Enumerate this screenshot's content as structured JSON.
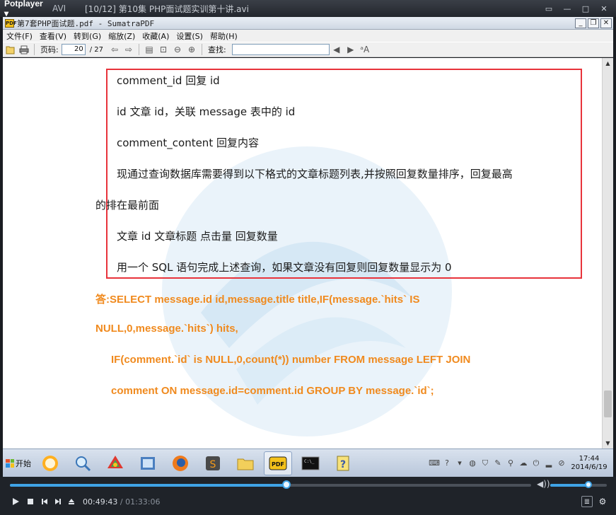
{
  "player": {
    "brand": "Potplayer",
    "format": "AVI",
    "file_title": "[10/12] 第10集 PHP面试题实训第十讲.avi",
    "current_time": "00:49:43",
    "total_time": "01:33:06",
    "progress": 0.531,
    "volume": 0.67
  },
  "sumatra": {
    "title": "第7套PHP面试题.pdf - SumatraPDF",
    "menu": [
      "文件(F)",
      "查看(V)",
      "转到(G)",
      "缩放(Z)",
      "收藏(A)",
      "设置(S)",
      "帮助(H)"
    ],
    "toolbar": {
      "page_label": "页码:",
      "page_value": "20",
      "page_total": "/ 27",
      "find_label": "查找:",
      "find_value": ""
    }
  },
  "document": {
    "lines": [
      "comment_id  回复 id",
      "id  文章 id，关联 message 表中的 id",
      "comment_content  回复内容",
      "现通过查询数据库需要得到以下格式的文章标题列表,并按照回复数量排序，回复最高",
      "的排在最前面",
      "文章 id  文章标题  点击量  回复数量",
      "用一个 SQL 语句完成上述查询，如果文章没有回复则回复数量显示为 0"
    ],
    "answer": [
      "答:SELECT message.id id,message.title title,IF(message.`hits` IS",
      "NULL,0,message.`hits`) hits,",
      "IF(comment.`id` is NULL,0,count(*)) number FROM message LEFT JOIN",
      "comment ON message.id=comment.id GROUP BY message.`id`;"
    ]
  },
  "taskbar": {
    "start_label": "开始",
    "apps": [
      "qq-icon",
      "magnifier-icon",
      "chrome-icon",
      "explorer-icon",
      "firefox-icon",
      "sublime-icon",
      "folder-icon",
      "sumatra-icon",
      "cmd-icon",
      "help-icon"
    ],
    "clock_time": "17:44",
    "clock_date": "2014/6/19"
  },
  "colors": {
    "highlight_box": "#e8333b",
    "answer_text": "#f08a1e",
    "seek_accent": "#3fa3e6"
  }
}
